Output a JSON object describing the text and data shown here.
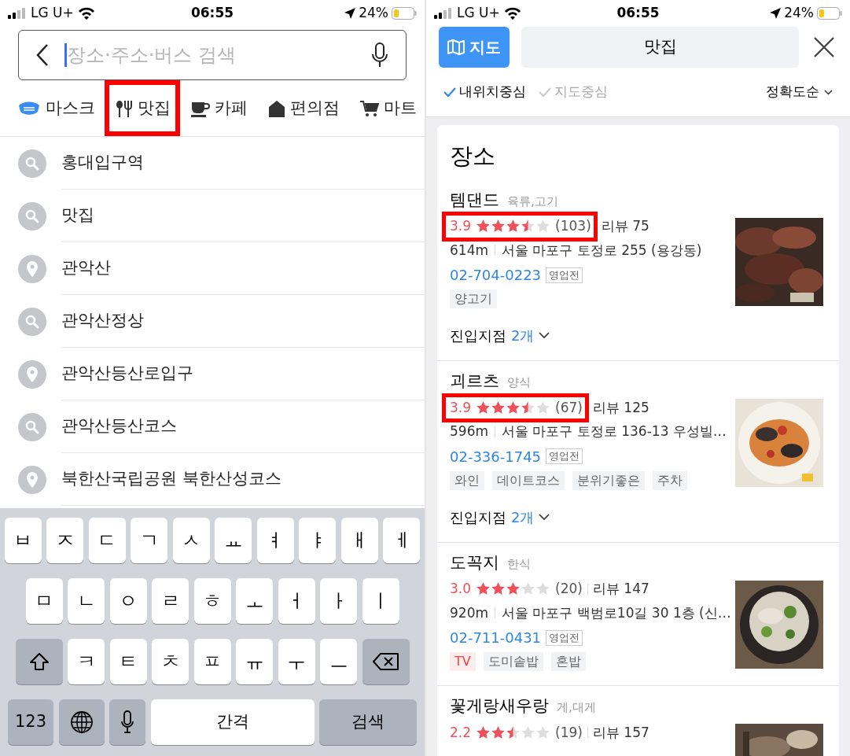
{
  "left_screen": {
    "status_bar": {
      "carrier": "LG U+",
      "time": "06:55",
      "battery": "24%"
    },
    "search": {
      "placeholder": "장소·주소·버스 검색"
    },
    "categories": [
      {
        "label": "마스크",
        "kind": "mask",
        "highlighted": false
      },
      {
        "label": "맛집",
        "kind": "food",
        "highlighted": true
      },
      {
        "label": "카페",
        "kind": "cafe",
        "highlighted": false
      },
      {
        "label": "편의점",
        "kind": "store",
        "highlighted": false
      },
      {
        "label": "마트",
        "kind": "cart",
        "highlighted": false
      }
    ],
    "history": [
      {
        "text": "홍대입구역",
        "kind": "search"
      },
      {
        "text": "맛집",
        "kind": "search"
      },
      {
        "text": "관악산",
        "kind": "place"
      },
      {
        "text": "관악산정상",
        "kind": "search"
      },
      {
        "text": "관악산등산로입구",
        "kind": "place"
      },
      {
        "text": "관악산등산코스",
        "kind": "search"
      },
      {
        "text": "북한산국립공원 북한산성코스",
        "kind": "place"
      }
    ],
    "keyboard": {
      "rows": [
        {
          "keys": [
            {
              "kind": "letter",
              "label": "ㅂ"
            },
            {
              "kind": "letter",
              "label": "ㅈ"
            },
            {
              "kind": "letter",
              "label": "ㄷ"
            },
            {
              "kind": "letter",
              "label": "ㄱ"
            },
            {
              "kind": "letter",
              "label": "ㅅ"
            },
            {
              "kind": "letter",
              "label": "ㅛ"
            },
            {
              "kind": "letter",
              "label": "ㅕ"
            },
            {
              "kind": "letter",
              "label": "ㅑ"
            },
            {
              "kind": "letter",
              "label": "ㅐ"
            },
            {
              "kind": "letter",
              "label": "ㅔ"
            }
          ]
        },
        {
          "keys": [
            {
              "kind": "letter",
              "label": "ㅁ"
            },
            {
              "kind": "letter",
              "label": "ㄴ"
            },
            {
              "kind": "letter",
              "label": "ㅇ"
            },
            {
              "kind": "letter",
              "label": "ㄹ"
            },
            {
              "kind": "letter",
              "label": "ㅎ"
            },
            {
              "kind": "letter",
              "label": "ㅗ"
            },
            {
              "kind": "letter",
              "label": "ㅓ"
            },
            {
              "kind": "letter",
              "label": "ㅏ"
            },
            {
              "kind": "letter",
              "label": "ㅣ"
            }
          ]
        },
        {
          "keys": [
            {
              "kind": "shift"
            },
            {
              "kind": "letter",
              "label": "ㅋ"
            },
            {
              "kind": "letter",
              "label": "ㅌ"
            },
            {
              "kind": "letter",
              "label": "ㅊ"
            },
            {
              "kind": "letter",
              "label": "ㅍ"
            },
            {
              "kind": "letter",
              "label": "ㅠ"
            },
            {
              "kind": "letter",
              "label": "ㅜ"
            },
            {
              "kind": "letter",
              "label": "ㅡ"
            },
            {
              "kind": "backspace"
            }
          ]
        },
        {
          "keys": [
            {
              "kind": "numbers",
              "label": "123"
            },
            {
              "kind": "globe"
            },
            {
              "kind": "mic"
            },
            {
              "kind": "space",
              "label": "간격"
            },
            {
              "kind": "return",
              "label": "검색"
            }
          ]
        }
      ]
    }
  },
  "right_screen": {
    "status_bar": {
      "carrier": "LG U+",
      "time": "06:55",
      "battery": "24%"
    },
    "map_button": {
      "label": "지도"
    },
    "query": "맛집",
    "filters": [
      {
        "label": "내위치중심",
        "checked": true
      },
      {
        "label": "지도중심",
        "checked": false
      }
    ],
    "sort": "정확도순",
    "section_title": "장소",
    "places": [
      {
        "name": "템댄드",
        "category": "육류,고기",
        "rating": "3.9",
        "stars": 3.5,
        "count": "(103)",
        "reviews": "리뷰 75",
        "highlighted": true,
        "distance": "614m",
        "address": "서울 마포구 토정로 255 (용강동)",
        "phone": "02-704-0223",
        "status": "영업전",
        "tags": [
          {
            "label": "양고기",
            "kind": "plain"
          }
        ],
        "entrances": {
          "label": "진입지점",
          "count": "2개"
        }
      },
      {
        "name": "괴르츠",
        "category": "양식",
        "rating": "3.9",
        "stars": 3.5,
        "count": "(67)",
        "reviews": "리뷰 125",
        "highlighted": true,
        "distance": "596m",
        "address": "서울 마포구 토정로 136-13 우성빌…",
        "phone": "02-336-1745",
        "status": "영업전",
        "tags": [
          {
            "label": "와인",
            "kind": "plain"
          },
          {
            "label": "데이트코스",
            "kind": "plain"
          },
          {
            "label": "분위기좋은",
            "kind": "plain"
          },
          {
            "label": "주차",
            "kind": "plain"
          }
        ],
        "entrances": {
          "label": "진입지점",
          "count": "2개"
        }
      },
      {
        "name": "도꼭지",
        "category": "한식",
        "rating": "3.0",
        "stars": 3,
        "count": "(20)",
        "reviews": "리뷰 147",
        "highlighted": false,
        "distance": "920m",
        "address": "서울 마포구 백범로10길 30 1층 (신…",
        "phone": "02-711-0431",
        "status": "영업전",
        "tags": [
          {
            "label": "TV",
            "kind": "highlight"
          },
          {
            "label": "도미솥밥",
            "kind": "plain"
          },
          {
            "label": "혼밥",
            "kind": "plain"
          }
        ]
      },
      {
        "name": "꽃게랑새우랑",
        "category": "게,대게",
        "rating": "2.2",
        "stars": 2.5,
        "count": "(19)",
        "reviews": "리뷰 157",
        "highlighted": false
      }
    ]
  }
}
